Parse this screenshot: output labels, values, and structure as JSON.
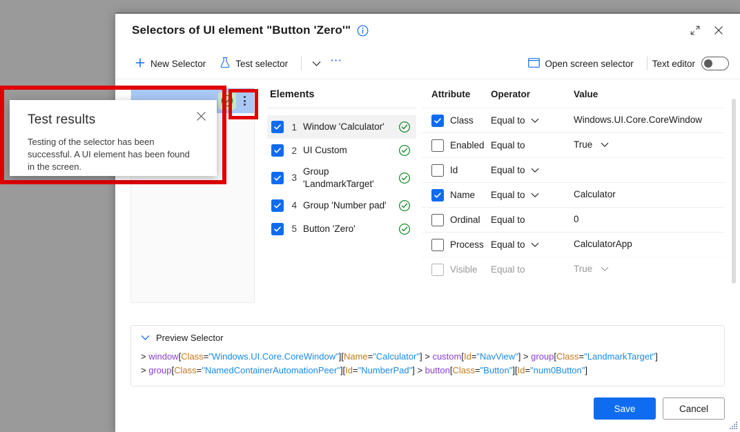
{
  "dialog": {
    "title": "Selectors of UI element \"Button 'Zero'\"",
    "info_icon": "info-icon",
    "restore_icon": "restore-icon",
    "close_icon": "close-icon"
  },
  "commandbar": {
    "new_selector": "New Selector",
    "new_selector_icon": "plus-icon",
    "test_selector": "Test selector",
    "test_selector_icon": "flask-icon",
    "caret_icon": "chevron-down-icon",
    "overflow_icon": "ellipsis-icon",
    "open_screen_selector": "Open screen selector",
    "open_screen_selector_icon": "screen-icon",
    "text_editor_label": "Text editor",
    "text_editor_on": false
  },
  "callout": {
    "title": "Test results",
    "message": "Testing of the selector has been successful. A UI element has been found in the screen.",
    "close_icon": "close-icon",
    "highlight_color": "#e00000"
  },
  "selector_card": {
    "status_icon": "check-circle-icon",
    "status_color": "#1a8a2e",
    "status_bg": "#c6e6c4",
    "header_bg": "#a9c8f5",
    "menu_icon": "kebab-menu-icon"
  },
  "elements": {
    "title": "Elements",
    "items": [
      {
        "index": "1",
        "label": "Window 'Calculator'",
        "checked": true,
        "status": "ok",
        "selected": true
      },
      {
        "index": "2",
        "label": "UI Custom",
        "checked": true,
        "status": "ok",
        "selected": false
      },
      {
        "index": "3",
        "label": "Group 'LandmarkTarget'",
        "checked": true,
        "status": "ok",
        "selected": false
      },
      {
        "index": "4",
        "label": "Group 'Number pad'",
        "checked": true,
        "status": "ok",
        "selected": false
      },
      {
        "index": "5",
        "label": "Button 'Zero'",
        "checked": true,
        "status": "ok",
        "selected": false
      }
    ]
  },
  "attributes": {
    "headers": {
      "attribute": "Attribute",
      "operator": "Operator",
      "value": "Value"
    },
    "rows": [
      {
        "name": "Class",
        "checked": true,
        "operator": "Equal to",
        "operator_dropdown": true,
        "value": "Windows.UI.Core.CoreWindow",
        "value_dropdown": false
      },
      {
        "name": "Enabled",
        "checked": false,
        "operator": "Equal to",
        "operator_dropdown": false,
        "value": "True",
        "value_dropdown": true
      },
      {
        "name": "Id",
        "checked": false,
        "operator": "Equal to",
        "operator_dropdown": true,
        "value": "",
        "value_dropdown": false
      },
      {
        "name": "Name",
        "checked": true,
        "operator": "Equal to",
        "operator_dropdown": true,
        "value": "Calculator",
        "value_dropdown": false
      },
      {
        "name": "Ordinal",
        "checked": false,
        "operator": "Equal to",
        "operator_dropdown": false,
        "value": "0",
        "value_dropdown": false
      },
      {
        "name": "Process",
        "checked": false,
        "operator": "Equal to",
        "operator_dropdown": true,
        "value": "CalculatorApp",
        "value_dropdown": false
      },
      {
        "name": "Visible",
        "checked": false,
        "operator": "Equal to",
        "operator_dropdown": false,
        "value": "True",
        "value_dropdown": true
      }
    ]
  },
  "preview": {
    "label": "Preview Selector",
    "expand_icon": "chevron-down-icon",
    "lines": [
      [
        {
          "t": "pun",
          "s": "> "
        },
        {
          "t": "el",
          "s": "window"
        },
        {
          "t": "pun",
          "s": "["
        },
        {
          "t": "attr",
          "s": "Class"
        },
        {
          "t": "pun",
          "s": "="
        },
        {
          "t": "str",
          "s": "\"Windows.UI.Core.CoreWindow\""
        },
        {
          "t": "pun",
          "s": "]["
        },
        {
          "t": "attr",
          "s": "Name"
        },
        {
          "t": "pun",
          "s": "="
        },
        {
          "t": "str",
          "s": "\"Calculator\""
        },
        {
          "t": "pun",
          "s": "] > "
        },
        {
          "t": "el",
          "s": "custom"
        },
        {
          "t": "pun",
          "s": "["
        },
        {
          "t": "attr",
          "s": "Id"
        },
        {
          "t": "pun",
          "s": "="
        },
        {
          "t": "str",
          "s": "\"NavView\""
        },
        {
          "t": "pun",
          "s": "] > "
        },
        {
          "t": "el",
          "s": "group"
        },
        {
          "t": "pun",
          "s": "["
        },
        {
          "t": "attr",
          "s": "Class"
        },
        {
          "t": "pun",
          "s": "="
        },
        {
          "t": "str",
          "s": "\"LandmarkTarget\""
        },
        {
          "t": "pun",
          "s": "]"
        }
      ],
      [
        {
          "t": "pun",
          "s": "> "
        },
        {
          "t": "el",
          "s": "group"
        },
        {
          "t": "pun",
          "s": "["
        },
        {
          "t": "attr",
          "s": "Class"
        },
        {
          "t": "pun",
          "s": "="
        },
        {
          "t": "str",
          "s": "\"NamedContainerAutomationPeer\""
        },
        {
          "t": "pun",
          "s": "]["
        },
        {
          "t": "attr",
          "s": "Id"
        },
        {
          "t": "pun",
          "s": "="
        },
        {
          "t": "str",
          "s": "\"NumberPad\""
        },
        {
          "t": "pun",
          "s": "] > "
        },
        {
          "t": "el",
          "s": "button"
        },
        {
          "t": "pun",
          "s": "["
        },
        {
          "t": "attr",
          "s": "Class"
        },
        {
          "t": "pun",
          "s": "="
        },
        {
          "t": "str",
          "s": "\"Button\""
        },
        {
          "t": "pun",
          "s": "]["
        },
        {
          "t": "attr",
          "s": "Id"
        },
        {
          "t": "pun",
          "s": "="
        },
        {
          "t": "str",
          "s": "\"num0Button\""
        },
        {
          "t": "pun",
          "s": "]"
        }
      ]
    ]
  },
  "footer": {
    "save": "Save",
    "cancel": "Cancel"
  },
  "colors": {
    "accent": "#0f6cf0",
    "success": "#1a8a2e",
    "highlight": "#e00000",
    "backdrop": "#9a9a9a"
  }
}
